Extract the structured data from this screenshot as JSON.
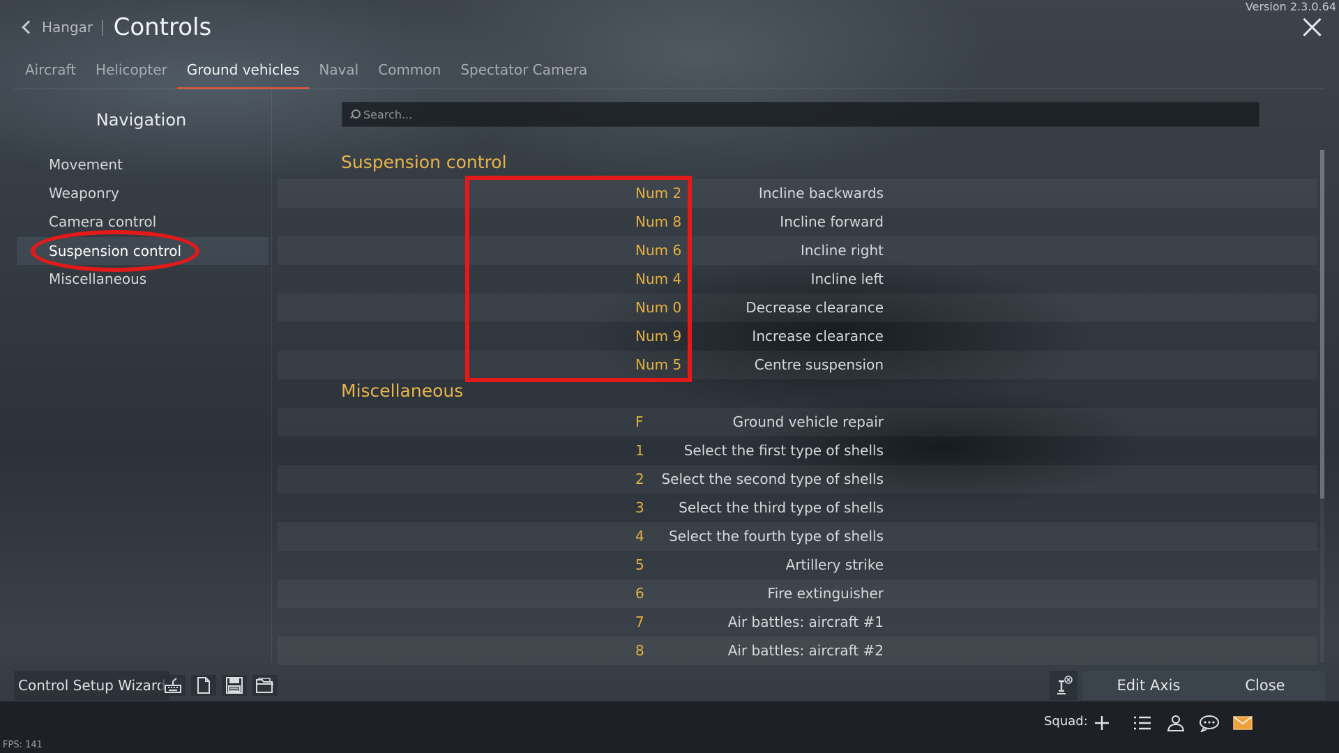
{
  "app": {
    "version": "Version 2.3.0.64"
  },
  "header": {
    "back_label": "Hangar",
    "separator": "|",
    "title": "Controls"
  },
  "tabs": [
    {
      "label": "Aircraft",
      "active": false
    },
    {
      "label": "Helicopter",
      "active": false
    },
    {
      "label": "Ground vehicles",
      "active": true
    },
    {
      "label": "Naval",
      "active": false
    },
    {
      "label": "Common",
      "active": false
    },
    {
      "label": "Spectator Camera",
      "active": false
    }
  ],
  "navigation": {
    "title": "Navigation",
    "items": [
      {
        "label": "Movement",
        "active": false
      },
      {
        "label": "Weaponry",
        "active": false
      },
      {
        "label": "Camera control",
        "active": false
      },
      {
        "label": "Suspension control",
        "active": true
      },
      {
        "label": "Miscellaneous",
        "active": false
      }
    ]
  },
  "search": {
    "placeholder": "Search...",
    "value": ""
  },
  "sections": [
    {
      "title": "Suspension control",
      "rows": [
        {
          "action": "Incline backwards",
          "key": "Num 2"
        },
        {
          "action": "Incline forward",
          "key": "Num 8"
        },
        {
          "action": "Incline right",
          "key": "Num 6"
        },
        {
          "action": "Incline left",
          "key": "Num 4"
        },
        {
          "action": "Decrease clearance",
          "key": "Num 0"
        },
        {
          "action": "Increase clearance",
          "key": "Num 9"
        },
        {
          "action": "Centre suspension",
          "key": "Num 5"
        }
      ]
    },
    {
      "title": "Miscellaneous",
      "rows": [
        {
          "action": "Ground vehicle repair",
          "key": "F"
        },
        {
          "action": "Select the first type of shells",
          "key": "1"
        },
        {
          "action": "Select the second type of shells",
          "key": "2"
        },
        {
          "action": "Select the third type of shells",
          "key": "3"
        },
        {
          "action": "Select the fourth type of shells",
          "key": "4"
        },
        {
          "action": "Artillery strike",
          "key": "5"
        },
        {
          "action": "Fire extinguisher",
          "key": "6"
        },
        {
          "action": "Air battles: aircraft #1",
          "key": "7"
        },
        {
          "action": "Air battles: aircraft #2",
          "key": "8"
        }
      ]
    }
  ],
  "toolbar": {
    "wizard_label": "Control Setup Wizard",
    "icons": [
      "keyboard-icon",
      "new-file-icon",
      "save-icon",
      "open-folder-icon"
    ],
    "edit_axis_label": "Edit Axis",
    "close_label": "Close"
  },
  "bottom_bar": {
    "squad_label": "Squad:",
    "icons": [
      "plus-icon",
      "list-icon",
      "contacts-icon",
      "chat-icon",
      "mail-icon"
    ]
  },
  "fps": "FPS: 141",
  "colors": {
    "accent": "#e8b44a",
    "active_tab_underline": "#c9553c",
    "annotation": "#e21a1a",
    "mail_icon": "#f0a03a"
  }
}
